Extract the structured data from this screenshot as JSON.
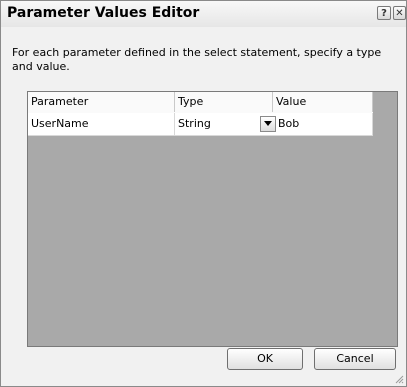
{
  "window": {
    "title": "Parameter Values Editor",
    "help_glyph": "?",
    "close_glyph": "✕"
  },
  "instructions": "For each parameter defined in the select statement, specify a type and value.",
  "grid": {
    "columns": [
      "Parameter",
      "Type",
      "Value"
    ],
    "rows": [
      {
        "parameter": "UserName",
        "type": "String",
        "value": "Bob"
      }
    ]
  },
  "buttons": {
    "ok": "OK",
    "cancel": "Cancel"
  },
  "icons": {
    "dropdown": "chevron-down-icon",
    "help": "help-icon",
    "close": "close-icon",
    "grip": "resize-grip-icon"
  },
  "colors": {
    "grid_background": "#a9a9a9",
    "window_background": "#f1f1f1"
  }
}
